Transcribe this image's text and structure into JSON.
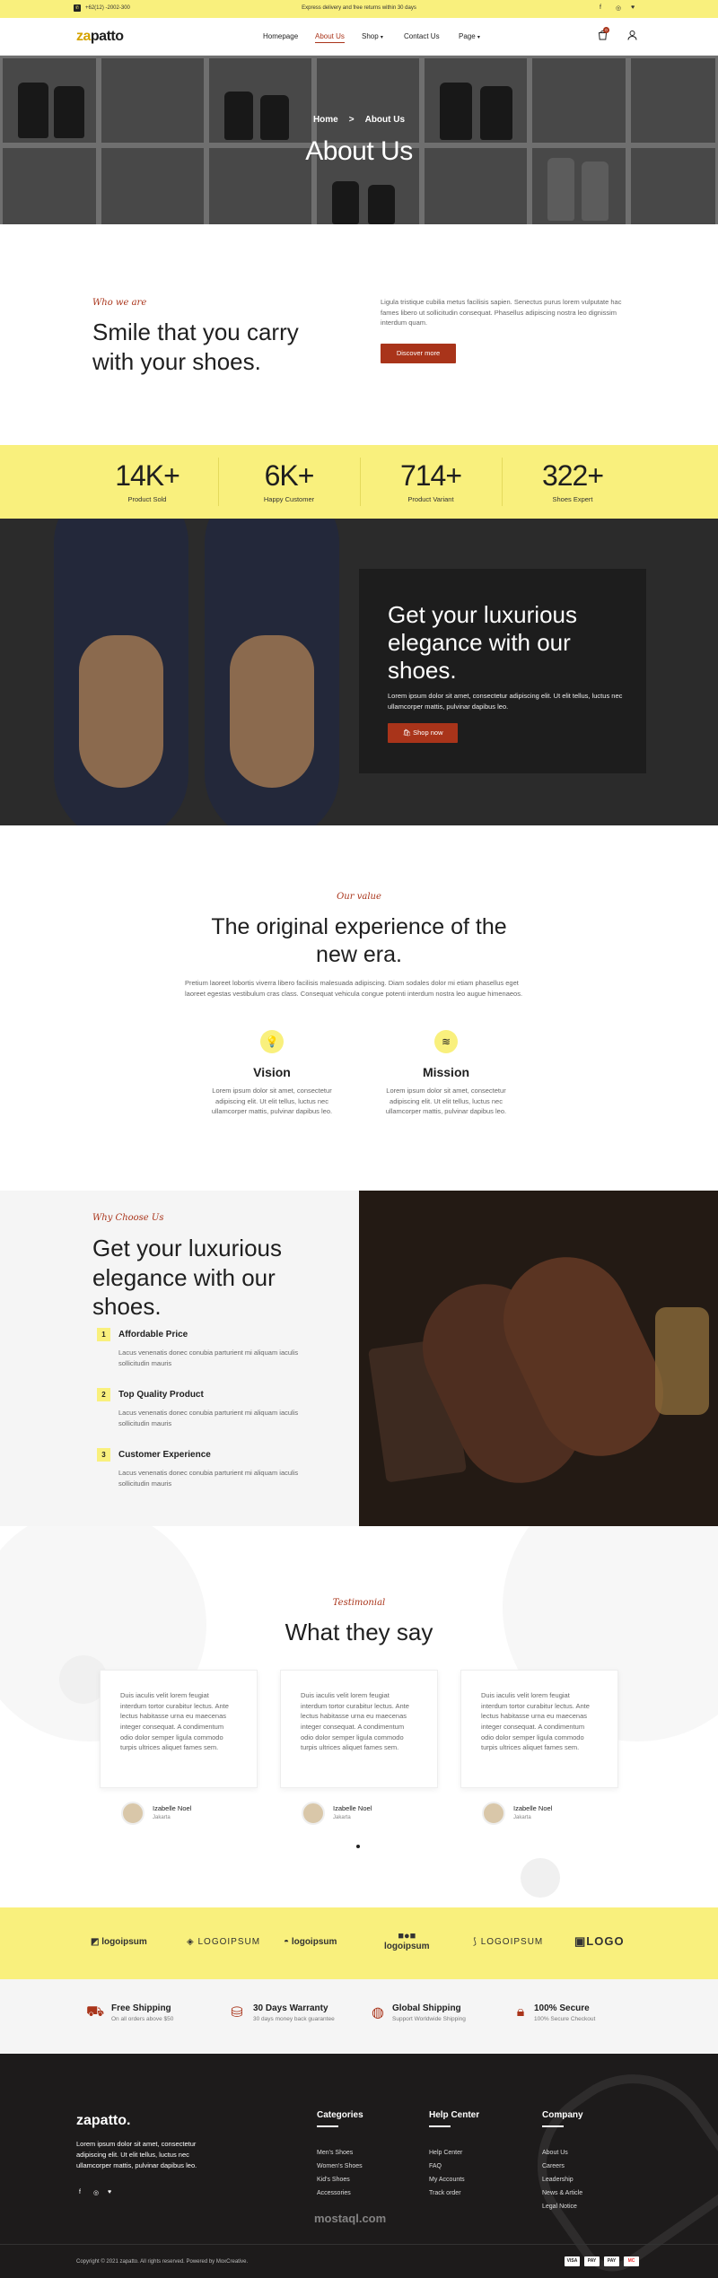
{
  "topbar": {
    "phone": "+62(12) -2002-300",
    "promo": "Express delivery and free returns within 30 days"
  },
  "brand": {
    "logo_accent": "za",
    "logo_rest": "patto"
  },
  "nav": {
    "items": [
      "Homepage",
      "About Us",
      "Shop",
      "Contact Us",
      "Page"
    ],
    "cart_count": "0"
  },
  "hero": {
    "breadcrumb_home": "Home",
    "breadcrumb_sep": ">",
    "breadcrumb_current": "About Us",
    "title": "About Us"
  },
  "who": {
    "kicker": "Who we are",
    "title_line1": "Smile that you carry",
    "title_line2": "with your shoes.",
    "body": "Ligula tristique cubilia metus facilisis sapien. Senectus purus lorem vulputate hac fames libero ut sollicitudin consequat. Phasellus adipiscing nostra leo dignissim interdum quam.",
    "button": "Discover more"
  },
  "stats": [
    {
      "value": "14K+",
      "label": "Product Sold"
    },
    {
      "value": "6K+",
      "label": "Happy Customer"
    },
    {
      "value": "714+",
      "label": "Product Variant"
    },
    {
      "value": "322+",
      "label": "Shoes Expert"
    }
  ],
  "luxury": {
    "title_line1": "Get your luxurious",
    "title_line2": "elegance with our",
    "title_line3": "shoes.",
    "body": "Lorem ipsum dolor sit amet, consectetur adipiscing elit. Ut elit tellus, luctus nec ullamcorper mattis, pulvinar dapibus leo.",
    "button": "Shop now"
  },
  "value": {
    "kicker": "Our value",
    "title_line1": "The original experience of the",
    "title_line2": "new era.",
    "body": "Pretium laoreet lobortis viverra libero facilisis malesuada adipiscing. Diam sodales dolor mi etiam phasellus eget laoreet egestas vestibulum cras class. Consequat vehicula congue potenti interdum nostra leo augue himenaeos.",
    "cards": [
      {
        "title": "Vision",
        "body": "Lorem ipsum dolor sit amet, consectetur adipiscing elit. Ut elit tellus, luctus nec ullamcorper mattis, pulvinar dapibus leo."
      },
      {
        "title": "Mission",
        "body": "Lorem ipsum dolor sit amet, consectetur adipiscing elit. Ut elit tellus, luctus nec ullamcorper mattis, pulvinar dapibus leo."
      }
    ]
  },
  "why": {
    "kicker": "Why Choose Us",
    "title_line1": "Get your luxurious",
    "title_line2": "elegance with our",
    "title_line3": "shoes.",
    "items": [
      {
        "num": "1",
        "title": "Affordable Price",
        "body": "Lacus venenatis donec conubia parturient mi aliquam iaculis sollicitudin mauris"
      },
      {
        "num": "2",
        "title": "Top Quality Product",
        "body": "Lacus venenatis donec conubia parturient mi aliquam iaculis sollicitudin mauris"
      },
      {
        "num": "3",
        "title": "Customer Experience",
        "body": "Lacus venenatis donec conubia parturient mi aliquam iaculis sollicitudin mauris"
      }
    ]
  },
  "testimonial": {
    "kicker": "Testimonial",
    "title": "What they say",
    "cards": [
      {
        "text": "Duis iaculis velit lorem feugiat interdum tortor curabitur lectus. Ante lectus habitasse urna eu maecenas integer consequat. A condimentum odio dolor semper ligula commodo turpis ultrices aliquet fames sem.",
        "name": "Izabelle Noel",
        "city": "Jakarta"
      },
      {
        "text": "Duis iaculis velit lorem feugiat interdum tortor curabitur lectus. Ante lectus habitasse urna eu maecenas integer consequat. A condimentum odio dolor semper ligula commodo turpis ultrices aliquet fames sem.",
        "name": "Izabelle Noel",
        "city": "Jakarta"
      },
      {
        "text": "Duis iaculis velit lorem feugiat interdum tortor curabitur lectus. Ante lectus habitasse urna eu maecenas integer consequat. A condimentum odio dolor semper ligula commodo turpis ultrices aliquet fames sem.",
        "name": "Izabelle Noel",
        "city": "Jakarta"
      }
    ]
  },
  "logos": [
    "logoipsum",
    "LOGOIPSUM",
    "logoipsum",
    "logoipsum",
    "LOGOIPSUM",
    "LOGO"
  ],
  "features": [
    {
      "title": "Free Shipping",
      "sub": "On all orders above $50"
    },
    {
      "title": "30 Days Warranty",
      "sub": "30 days money back guarantee"
    },
    {
      "title": "Global Shipping",
      "sub": "Support Worldwide Shipping"
    },
    {
      "title": "100% Secure",
      "sub": "100% Secure Checkout"
    }
  ],
  "footer": {
    "logo": "zapatto.",
    "about": "Lorem ipsum dolor sit amet, consectetur adipiscing elit. Ut elit tellus, luctus nec ullamcorper mattis, pulvinar dapibus leo.",
    "col1_title": "Categories",
    "col1": [
      "Men's Shoes",
      "Women's Shoes",
      "Kid's Shoes",
      "Accessories"
    ],
    "col2_title": "Help Center",
    "col2": [
      "Help Center",
      "FAQ",
      "My Accounts",
      "Track order"
    ],
    "col3_title": "Company",
    "col3": [
      "About Us",
      "Careers",
      "Leadership",
      "News & Article",
      "Legal Notice"
    ],
    "copyright": "Copyright © 2021 zapatto. All rights reserved. Powered by MoxCreative.",
    "watermark": "mostaql.com",
    "payments": [
      "VISA",
      "PAY",
      "PAY",
      "MC"
    ]
  }
}
